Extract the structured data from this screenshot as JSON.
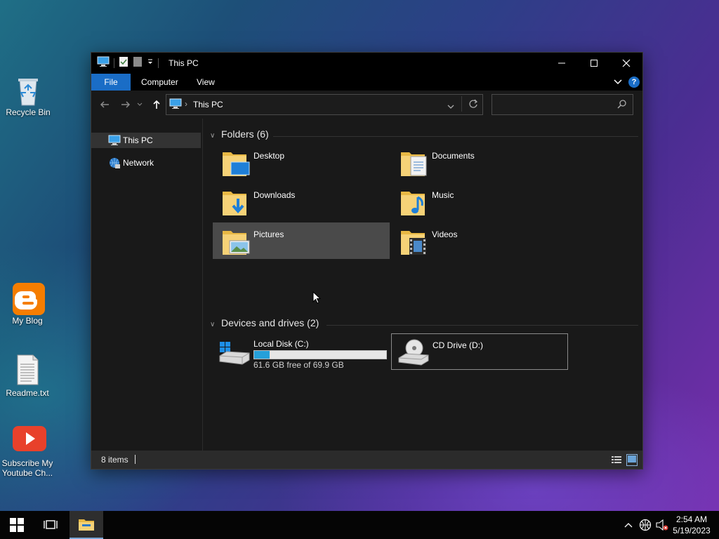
{
  "desktop": {
    "icons": [
      {
        "label": "Recycle Bin",
        "icon": "recycle-bin-icon"
      },
      {
        "label": "My Blog",
        "icon": "blogger-icon",
        "color": "#f57d00"
      },
      {
        "label": "Readme.txt",
        "icon": "text-file-icon"
      },
      {
        "label": "Subscribe My Youtube Ch...",
        "line1": "Subscribe My",
        "line2": "Youtube Ch...",
        "icon": "youtube-icon",
        "color": "#e8412b"
      }
    ]
  },
  "window": {
    "title": "This PC",
    "controls": {
      "minimize": "minimize-icon",
      "maximize": "maximize-icon",
      "close": "close-icon"
    },
    "ribbon_tabs": [
      "File",
      "Computer",
      "View"
    ],
    "accent": "#1a6dc6",
    "address": {
      "crumb": "This PC"
    },
    "search": {
      "placeholder": ""
    },
    "nav_pane": [
      {
        "label": "This PC",
        "icon": "computer-icon",
        "selected": true
      },
      {
        "label": "Network",
        "icon": "network-icon",
        "selected": false
      }
    ],
    "groups": {
      "folders": {
        "header": "Folders (6)"
      },
      "drives": {
        "header": "Devices and drives (2)"
      }
    },
    "folders": [
      {
        "name": "Desktop",
        "icon": "desktop-folder-icon"
      },
      {
        "name": "Documents",
        "icon": "documents-folder-icon"
      },
      {
        "name": "Downloads",
        "icon": "downloads-folder-icon"
      },
      {
        "name": "Music",
        "icon": "music-folder-icon"
      },
      {
        "name": "Pictures",
        "icon": "pictures-folder-icon",
        "selected": true
      },
      {
        "name": "Videos",
        "icon": "videos-folder-icon"
      }
    ],
    "drives": [
      {
        "name": "Local Disk (C:)",
        "free_text": "61.6 GB free of 69.9 GB",
        "used_fraction": 0.119,
        "icon": "local-disk-icon",
        "bar_color": "#26a0da"
      },
      {
        "name": "CD Drive (D:)",
        "icon": "cd-drive-icon"
      }
    ],
    "status": {
      "items": "8 items"
    }
  },
  "taskbar": {
    "buttons": [
      "start-icon",
      "task-view-icon",
      "file-explorer-icon"
    ],
    "tray": [
      "chevron-up-icon",
      "network-globe-icon",
      "volume-muted-icon"
    ],
    "time": "2:54 AM",
    "date": "5/19/2023"
  }
}
